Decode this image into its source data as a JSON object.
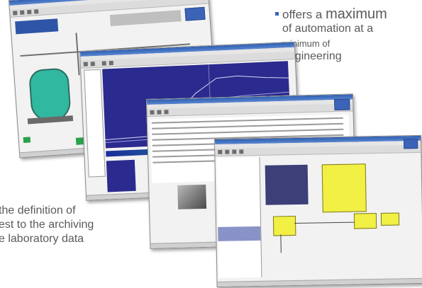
{
  "bullet_right": {
    "line1_small": "offers a ",
    "line1_big": "maximum",
    "line2": "of automation at a",
    "line3": "minimum of",
    "line4": "engineering"
  },
  "text_left": {
    "line1": "the definition of",
    "line2": "est to the archiving",
    "line3": "e laboratory data"
  },
  "colors": {
    "accent": "#3a62c0",
    "text": "#5a5a5a",
    "plot_bg": "#2b2a8f",
    "vessel": "#31b8a0",
    "highlight": "#f2ef45"
  }
}
